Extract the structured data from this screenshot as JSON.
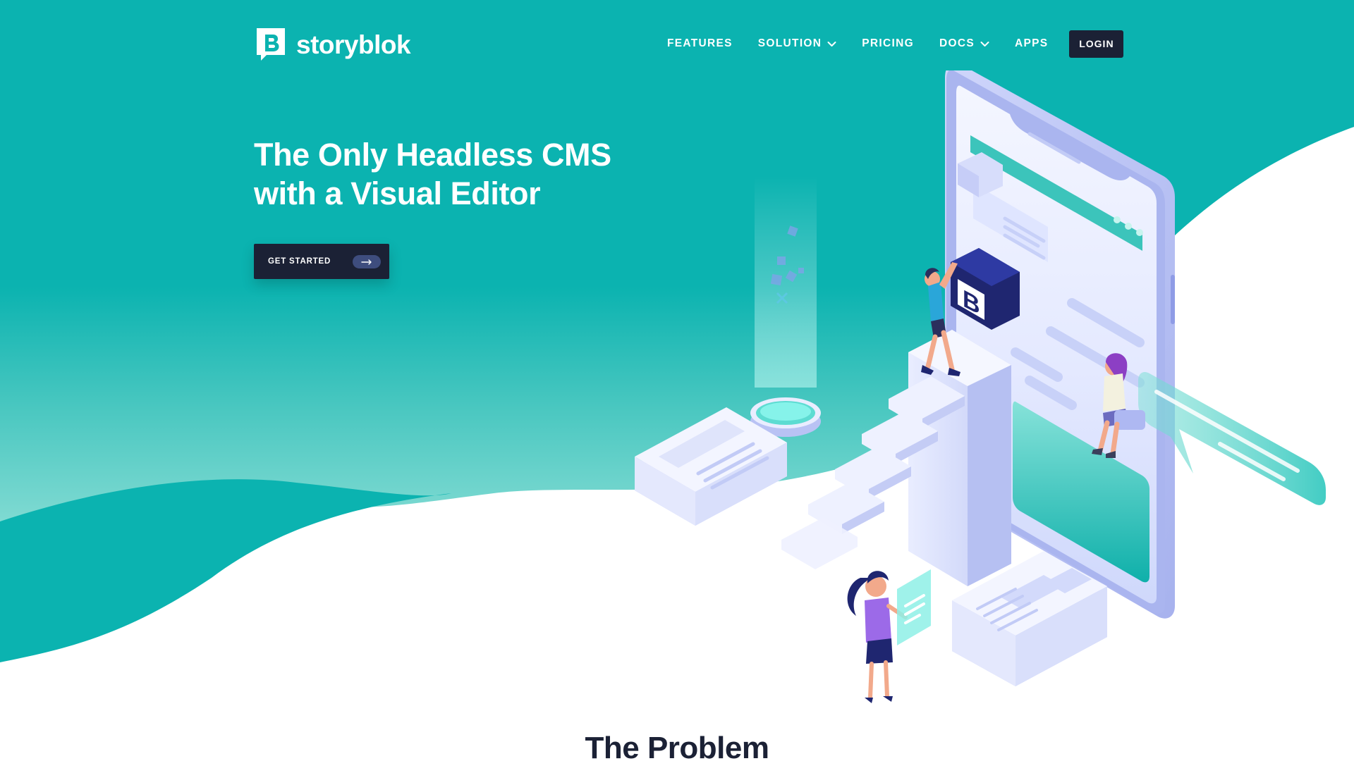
{
  "brand": {
    "name": "storyblok",
    "logo_icon": "storyblok-logo-icon"
  },
  "nav": {
    "items": [
      {
        "label": "FEATURES",
        "has_dropdown": false
      },
      {
        "label": "SOLUTION",
        "has_dropdown": true
      },
      {
        "label": "PRICING",
        "has_dropdown": false
      },
      {
        "label": "DOCS",
        "has_dropdown": true
      },
      {
        "label": "APPS",
        "has_dropdown": false
      }
    ],
    "login_label": "LOGIN"
  },
  "hero": {
    "title_line1": "The Only Headless CMS",
    "title_line2": "with a Visual Editor",
    "cta_label": "GET STARTED",
    "cta_icon": "arrow-right-icon",
    "illustration": "isometric-phone-cms-illustration"
  },
  "section": {
    "heading": "The Problem"
  },
  "colors": {
    "teal": "#0bb3b0",
    "teal_light": "#5fd3cc",
    "navy": "#1b2135",
    "white": "#ffffff"
  }
}
